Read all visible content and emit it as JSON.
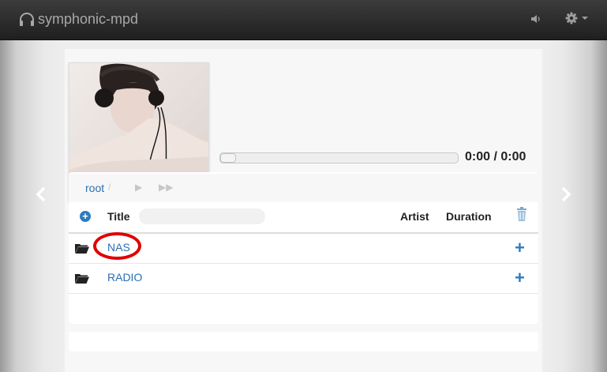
{
  "app": {
    "title": "symphonic-mpd"
  },
  "nav": {
    "volume_icon": "volume-icon",
    "settings_icon": "gear-icon"
  },
  "player": {
    "time": "0:00 / 0:00",
    "progress_fraction": 0.0
  },
  "breadcrumb": {
    "root": "root"
  },
  "table": {
    "headers": {
      "title": "Title",
      "artist": "Artist",
      "duration": "Duration"
    },
    "search_placeholder": "",
    "rows": [
      {
        "name": "NAS",
        "icon": "folder-open-icon",
        "action_icon": "plus-icon"
      },
      {
        "name": "RADIO",
        "icon": "folder-open-icon",
        "action_icon": "plus-icon"
      }
    ]
  },
  "colors": {
    "link": "#2a6fb3",
    "accent": "#2f7bbf",
    "navbar": "#2a2a2a",
    "highlight": "#e00000"
  }
}
